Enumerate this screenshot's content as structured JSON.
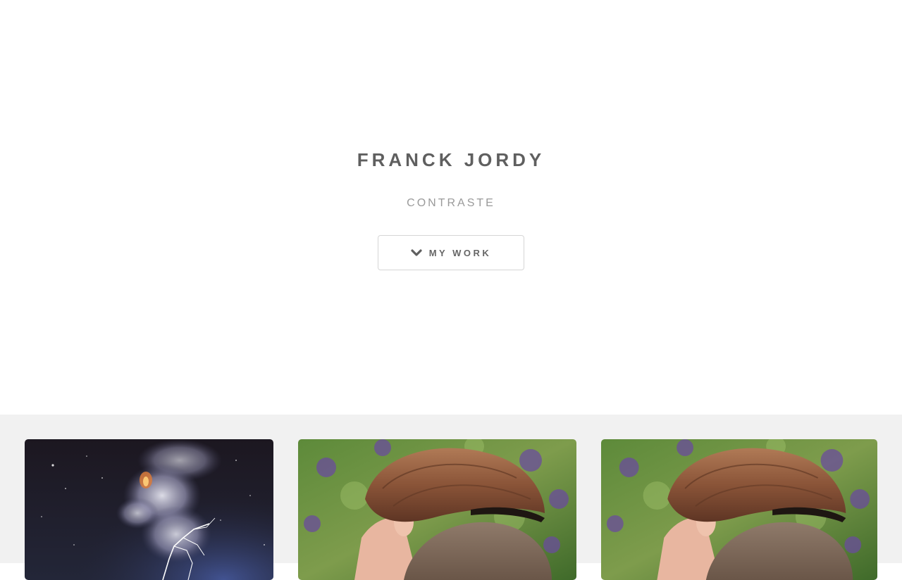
{
  "hero": {
    "title": "FRANCK JORDY",
    "subtitle": "CONTRASTE",
    "button_label": "MY WORK",
    "button_icon": "chevron-down-icon"
  },
  "gallery": {
    "items": [
      {
        "name": "lightning-volcano-photo",
        "description": "Night eruption with lightning"
      },
      {
        "name": "snail-photo",
        "description": "Hand holding snail"
      },
      {
        "name": "snail-photo",
        "description": "Hand holding snail"
      }
    ]
  },
  "colors": {
    "background": "#ffffff",
    "gallery_background": "#f1f1f1",
    "title": "#5f5f5f",
    "subtitle": "#9a9a9a",
    "button_border": "#d6d6d6"
  }
}
